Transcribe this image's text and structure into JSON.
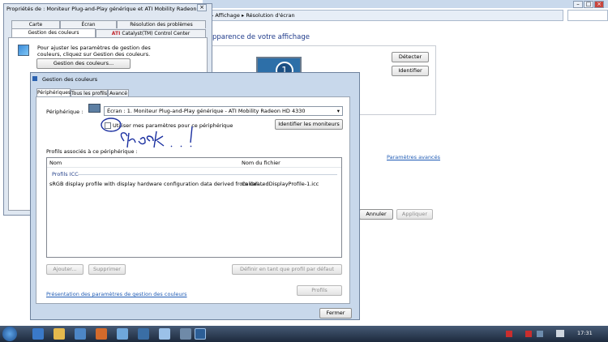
{
  "display_window": {
    "breadcrumb_1": "Affichage",
    "breadcrumb_2": "Résolution d'écran",
    "heading": "pparence de votre affichage",
    "detect_button": "Détecter",
    "identify_button": "Identifier",
    "monitor_number": "1",
    "advanced_link": "Paramètres avancés",
    "cancel_button": "Annuler",
    "apply_button": "Appliquer"
  },
  "properties_window": {
    "title": "Propriétés de : Moniteur Plug-and-Play générique et ATI Mobility Radeon H...",
    "tabs_row1": [
      "Carte",
      "Écran",
      "Résolution des problèmes"
    ],
    "tabs_row2": [
      "Gestion des couleurs",
      "Catalyst(TM) Control Center"
    ],
    "description": "Pour ajuster les paramètres de gestion des couleurs, cliquez sur Gestion des couleurs.",
    "button": "Gestion des couleurs..."
  },
  "color_dialog": {
    "title": "Gestion des couleurs",
    "tabs": [
      "Périphériques",
      "Tous les profils",
      "Avancé"
    ],
    "device_label": "Périphérique :",
    "device_value": "Écran : 1. Moniteur Plug-and-Play générique - ATI Mobility Radeon HD 4330",
    "checkbox_label": "Utiliser mes paramètres pour ce périphérique",
    "identify_button": "Identifier les moniteurs",
    "profiles_label": "Profils associés à ce périphérique :",
    "col_name": "Nom",
    "col_file": "Nom du fichier",
    "group_label": "Profils ICC",
    "profile_name": "sRGB display profile with display hardware configuration data derived from cali...",
    "profile_file": "CalibratedDisplayProfile-1.icc",
    "add_button": "Ajouter...",
    "remove_button": "Supprimer",
    "default_button": "Définir en tant que profil par défaut",
    "profiles_button": "Profils",
    "overview_link": "Présentation des paramètres de gestion des couleurs",
    "close_button": "Fermer"
  },
  "annotation": "Check . !",
  "taskbar": {
    "clock": "17:31"
  }
}
